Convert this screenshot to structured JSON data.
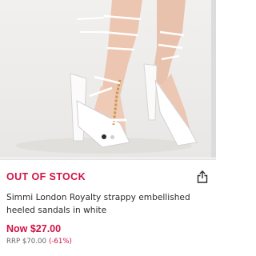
{
  "product": {
    "stock_status": "OUT OF STOCK",
    "title": "Simmi London Royalty strappy embellished heeled sandals in white",
    "price_now": "Now $27.00",
    "rrp": "RRP $70.00",
    "discount": "(-61%)"
  },
  "gallery": {
    "image_icon": "sandals-photo",
    "dots_count": 2,
    "active_dot": 0
  },
  "icons": {
    "share": "share-icon"
  },
  "colors": {
    "accent": "#d01345",
    "text": "#2d2d2d",
    "muted": "#666666"
  }
}
